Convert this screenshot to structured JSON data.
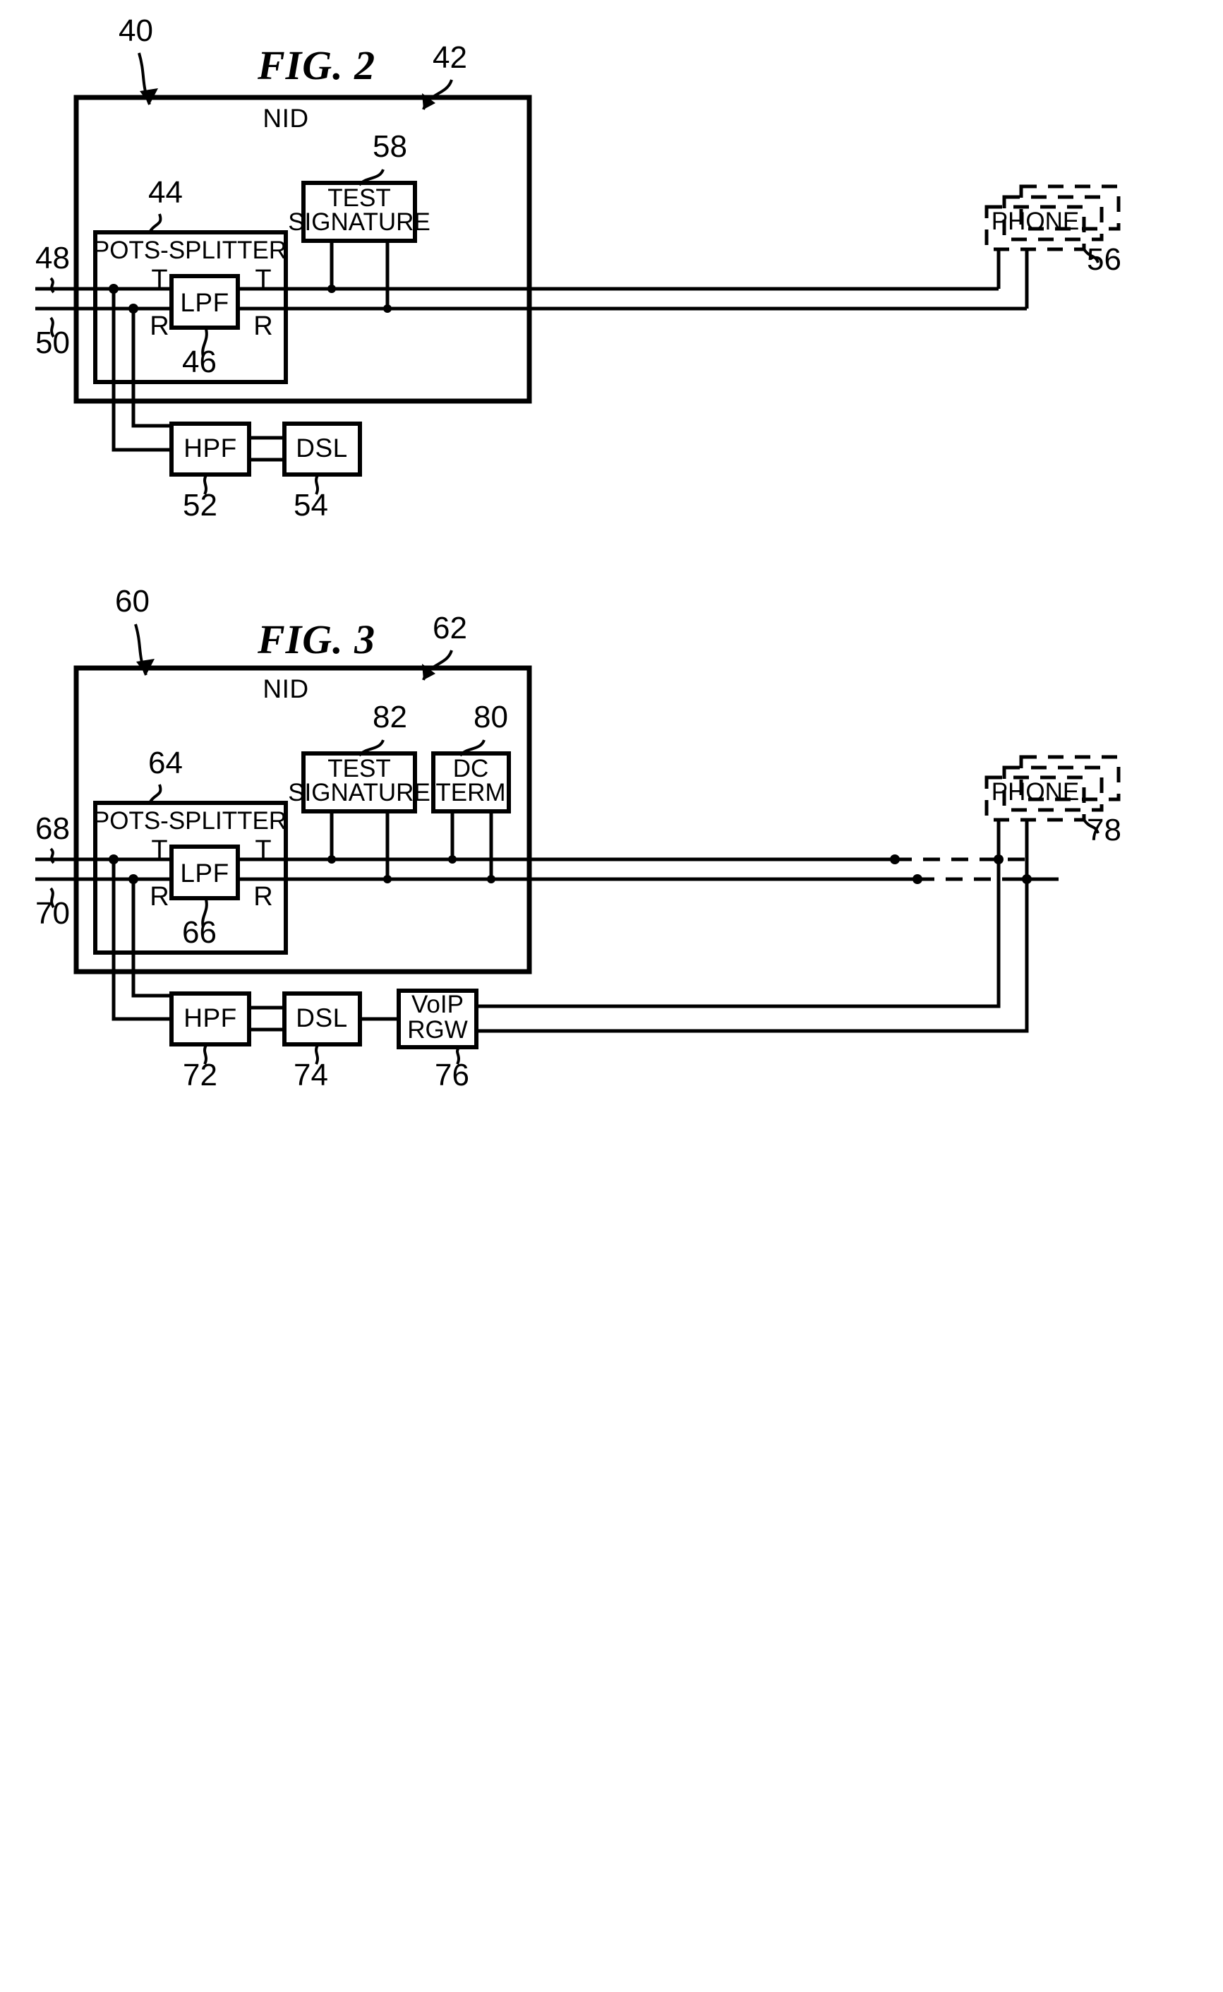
{
  "document": {
    "kind": "patent-drawing-sheet",
    "figures": [
      {
        "id": "fig2",
        "title": "FIG. 2",
        "system_ref": "40",
        "enclosure": {
          "label": "NID",
          "ref": "42"
        },
        "blocks": [
          {
            "name": "pots-splitter",
            "label": "POTS-SPLITTER",
            "ref": "44"
          },
          {
            "name": "lpf",
            "label": "LPF",
            "ref": "46"
          },
          {
            "name": "test-signature",
            "label_line1": "TEST",
            "label_line2": "SIGNATURE",
            "ref": "58"
          },
          {
            "name": "phone",
            "label": "PHONE",
            "ref": "56"
          },
          {
            "name": "hpf",
            "label": "HPF",
            "ref": "52"
          },
          {
            "name": "dsl",
            "label": "DSL",
            "ref": "54"
          }
        ],
        "line_refs": [
          {
            "name": "tip-line",
            "ref": "48"
          },
          {
            "name": "ring-line",
            "ref": "50"
          }
        ],
        "terminals": {
          "tip": "T",
          "ring": "R"
        }
      },
      {
        "id": "fig3",
        "title": "FIG. 3",
        "system_ref": "60",
        "enclosure": {
          "label": "NID",
          "ref": "62"
        },
        "blocks": [
          {
            "name": "pots-splitter",
            "label": "POTS-SPLITTER",
            "ref": "64"
          },
          {
            "name": "lpf",
            "label": "LPF",
            "ref": "66"
          },
          {
            "name": "test-signature",
            "label_line1": "TEST",
            "label_line2": "SIGNATURE",
            "ref": "82"
          },
          {
            "name": "dc-term",
            "label_line1": "DC",
            "label_line2": "TERM",
            "ref": "80"
          },
          {
            "name": "phone",
            "label": "PHONE",
            "ref": "78"
          },
          {
            "name": "hpf",
            "label": "HPF",
            "ref": "72"
          },
          {
            "name": "dsl",
            "label": "DSL",
            "ref": "74"
          },
          {
            "name": "voip-rgw",
            "label_line1": "VoIP",
            "label_line2": "RGW",
            "ref": "76"
          }
        ],
        "line_refs": [
          {
            "name": "tip-line",
            "ref": "68"
          },
          {
            "name": "ring-line",
            "ref": "70"
          }
        ],
        "terminals": {
          "tip": "T",
          "ring": "R"
        }
      }
    ]
  },
  "colors": {
    "ink": "#000000",
    "paper": "#ffffff"
  }
}
